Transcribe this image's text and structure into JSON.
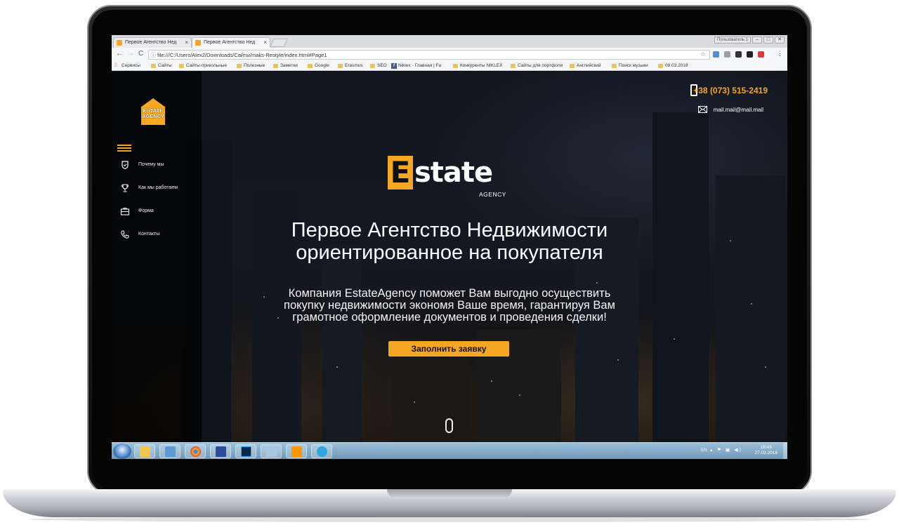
{
  "browser": {
    "tabs": [
      {
        "title": "Первое Агентство Нед"
      },
      {
        "title": "Первое Агентство Нед"
      }
    ],
    "tab_close": "×",
    "user_chip": "Пользователь 1",
    "window_buttons": [
      "–",
      "□",
      "✕"
    ],
    "back": "←",
    "forward": "→",
    "reload": "C",
    "address": "file:///C:/Users/Alex2/Downloads/Сайты/maks-Restyle/index.html#Page1",
    "info_icon": "ⓘ",
    "star": "☆",
    "menu": "⋮",
    "bookmarks": [
      {
        "label": "Сервисы",
        "kind": "apps"
      },
      {
        "label": "Сайты",
        "kind": "folder"
      },
      {
        "label": "Сайты-прикольные",
        "kind": "folder"
      },
      {
        "label": "Полезные",
        "kind": "folder"
      },
      {
        "label": "Заметки",
        "kind": "folder"
      },
      {
        "label": "Google",
        "kind": "folder"
      },
      {
        "label": "Erasmus",
        "kind": "folder"
      },
      {
        "label": "SEO",
        "kind": "folder"
      },
      {
        "label": "Niklex - Главная | Fa",
        "kind": "facebook"
      },
      {
        "label": "Конкуренты NIKLEX",
        "kind": "folder"
      },
      {
        "label": "Сайты для портфоли",
        "kind": "folder"
      },
      {
        "label": "Английский",
        "kind": "folder"
      },
      {
        "label": "Поиск музыки",
        "kind": "folder"
      },
      {
        "label": "09.03.2018",
        "kind": "folder"
      }
    ]
  },
  "site": {
    "logo": {
      "line1": "ESTATE",
      "line2": "AGENCY"
    },
    "nav": [
      {
        "label": "Почему мы",
        "icon": "shield-icon"
      },
      {
        "label": "Как мы работаем",
        "icon": "trophy-icon"
      },
      {
        "label": "Форма",
        "icon": "briefcase-icon"
      },
      {
        "label": "Контакты",
        "icon": "phone-handset-icon"
      }
    ],
    "phone": "+38 (073) 515-2419",
    "email": "mail.mail@mail.mail",
    "brand": {
      "initial": "E",
      "rest": "state",
      "sub": "AGENCY"
    },
    "headline_line1": "Первое Агентство Недвижимости",
    "headline_line2": "ориентированное на покупателя",
    "lead_line1": "Компания EstateAgency поможет Вам выгодно осуществить",
    "lead_line2": "покупку недвижимости экономя Ваше время, гарантируя Вам",
    "lead_line3": "грамотное оформление документов и проведения сделки!",
    "cta": "Заполнить заявку"
  },
  "taskbar": {
    "lang": "EN",
    "tray_icons": "▴ ⚑ ▣ ◀)",
    "time": "18:43",
    "date": "27.03.2018"
  },
  "colors": {
    "accent": "#f5a623",
    "page_bg": "#111620",
    "sidebar_bg": "#000000"
  }
}
